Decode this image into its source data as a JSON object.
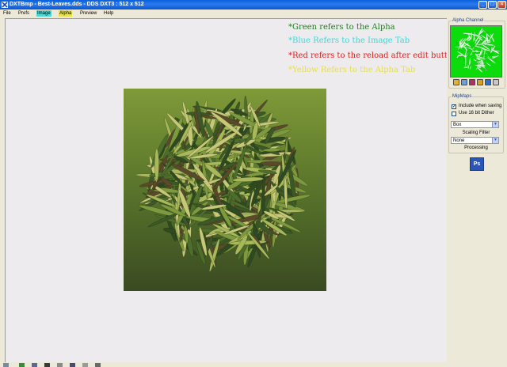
{
  "window": {
    "title": "DXTBmp - Best-Leaves.dds - DDS DXT3 : 512 x 512",
    "icon": "dxtbmp-app-icon",
    "controls": [
      "minimize",
      "maximize",
      "close"
    ]
  },
  "menu": {
    "items": [
      {
        "label": "File"
      },
      {
        "label": "Prefs"
      },
      {
        "label": "Image",
        "highlight": "#56D6D2"
      },
      {
        "label": "Alpha",
        "highlight": "#E6E052"
      },
      {
        "label": "Preview"
      },
      {
        "label": "Help"
      }
    ]
  },
  "notes": {
    "green": "*Green refers to the Alpha",
    "blue": "*Blue Refers to the Image Tab",
    "red": "*Red refers to the reload after edit button",
    "yellow": "*Yellow Refers to the Alpha Tab"
  },
  "colors": {
    "green": "#1E7F1E",
    "blue": "#3DD6D6",
    "red": "#D62020",
    "yellow": "#E4E04E",
    "alpha_bg": "#0CDC0C"
  },
  "alpha_channel": {
    "label": "Alpha Channel",
    "tool_icons": [
      "open-icon",
      "reload-icon",
      "edit-icon",
      "save-icon",
      "image-icon",
      "zoom-icon"
    ]
  },
  "mipmaps": {
    "label": "MipMaps",
    "include_when_saving": {
      "label": "Include when saving",
      "checked": true
    },
    "use_16bit_dither": {
      "label": "Use 16 bit Dither",
      "checked": false
    },
    "filter_value": "Box",
    "scaling_filter_label": "Scaling Filter",
    "scaling_value": "None",
    "processing_label": "Processing"
  },
  "photoshop_button": {
    "label": "Ps"
  }
}
